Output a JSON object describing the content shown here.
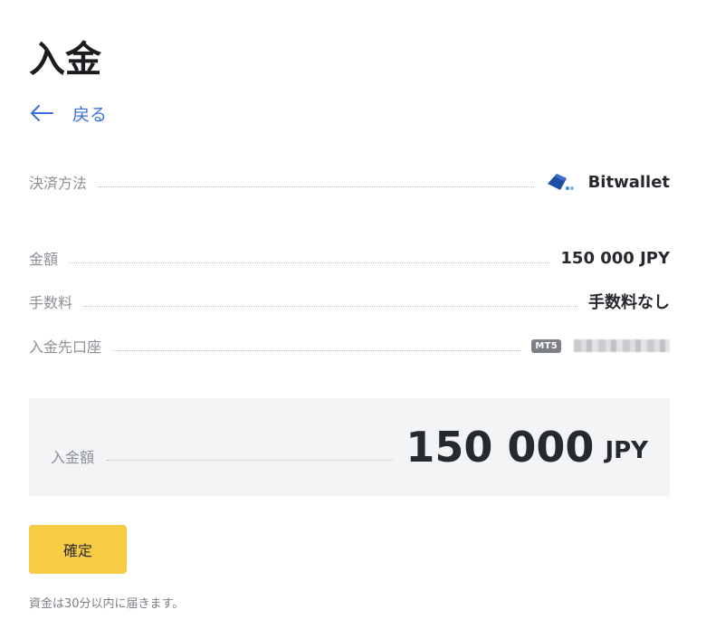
{
  "page": {
    "title": "入金",
    "back_label": "戻る"
  },
  "details": {
    "payment_method": {
      "label": "決済方法",
      "value": "Bitwallet",
      "icon": "bitwallet-logo-icon"
    },
    "amount": {
      "label": "金額",
      "value": "150 000 JPY"
    },
    "fee": {
      "label": "手数料",
      "value": "手数料なし"
    },
    "account": {
      "label": "入金先口座",
      "badge": "MT5",
      "value_masked": true
    }
  },
  "summary": {
    "label": "入金額",
    "amount": "150 000",
    "currency": "JPY"
  },
  "actions": {
    "confirm_label": "確定"
  },
  "note": "資金は30分以内に届きます。",
  "colors": {
    "accent_link": "#3a6fd8",
    "confirm_button": "#f7cc45",
    "summary_bg": "#f3f4f6",
    "bitwallet_blue": "#1f4fa3"
  }
}
